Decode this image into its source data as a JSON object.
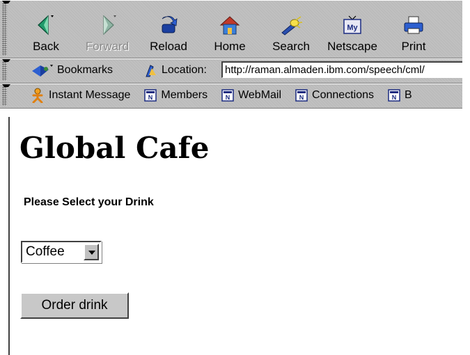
{
  "toolbar": {
    "buttons": [
      {
        "label": "Back",
        "icon": "back-arrow-icon",
        "enabled": true
      },
      {
        "label": "Forward",
        "icon": "forward-arrow-icon",
        "enabled": false
      },
      {
        "label": "Reload",
        "icon": "reload-icon",
        "enabled": true
      },
      {
        "label": "Home",
        "icon": "home-icon",
        "enabled": true
      },
      {
        "label": "Search",
        "icon": "search-flashlight-icon",
        "enabled": true
      },
      {
        "label": "Netscape",
        "icon": "netscape-my-icon",
        "enabled": true
      },
      {
        "label": "Print",
        "icon": "printer-icon",
        "enabled": true
      }
    ]
  },
  "location_bar": {
    "bookmarks_label": "Bookmarks",
    "location_label": "Location:",
    "url": "http://raman.almaden.ibm.com/speech/cml/"
  },
  "personal_toolbar": {
    "items": [
      {
        "label": "Instant Message",
        "icon": "instant-message-person-icon"
      },
      {
        "label": "Members",
        "icon": "bookmark-document-icon"
      },
      {
        "label": "WebMail",
        "icon": "bookmark-document-icon"
      },
      {
        "label": "Connections",
        "icon": "bookmark-document-icon"
      },
      {
        "label": "B",
        "icon": "bookmark-document-icon"
      }
    ]
  },
  "page": {
    "title": "Global Cafe",
    "prompt": "Please Select your Drink",
    "drink_select": {
      "selected": "Coffee"
    },
    "order_button_label": "Order drink"
  },
  "colors": {
    "chrome_gray": "#c0c0c0",
    "page_background": "#ffffff",
    "disabled_text": "#8a8a8a"
  }
}
